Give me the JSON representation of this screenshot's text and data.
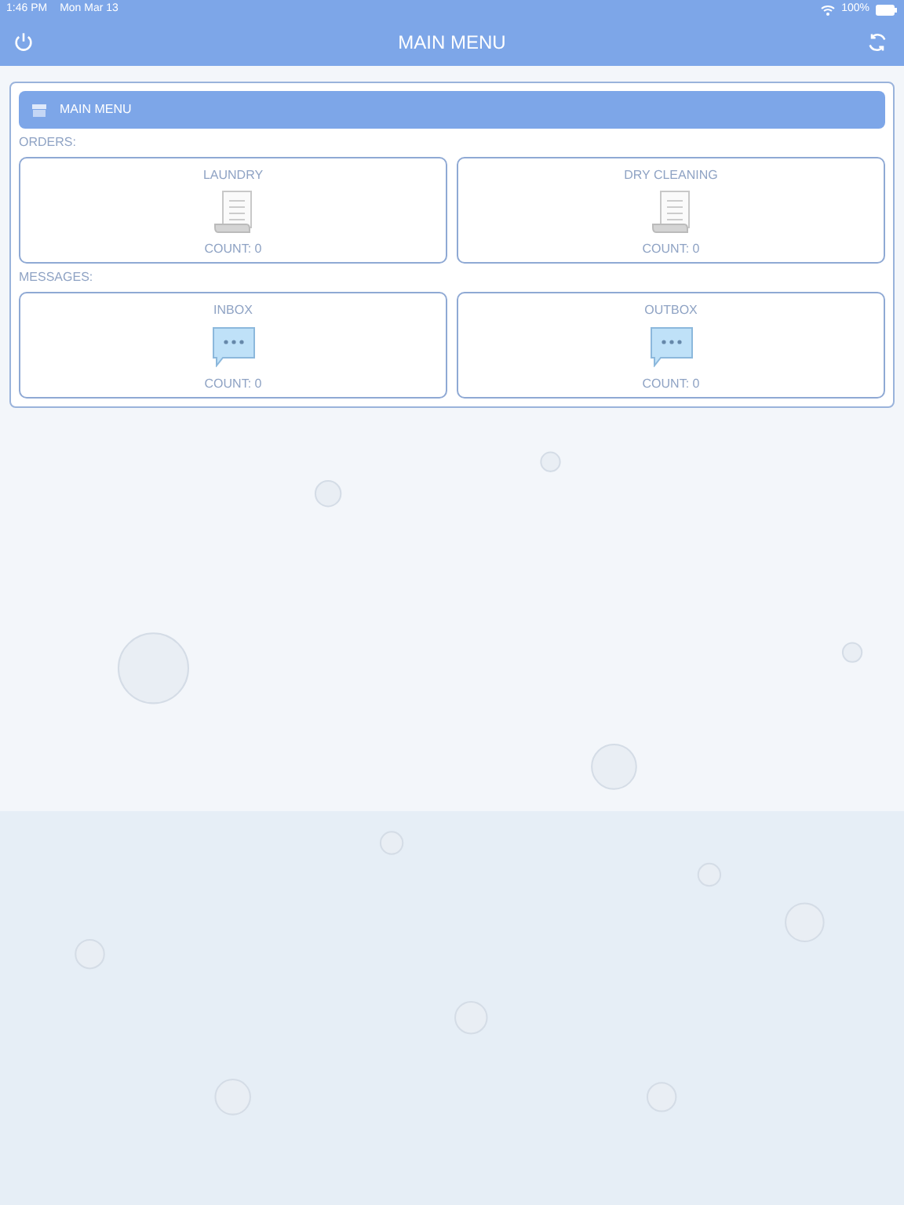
{
  "status_bar": {
    "time": "1:46 PM",
    "date": "Mon Mar 13",
    "battery": "100%"
  },
  "header": {
    "title": "MAIN MENU"
  },
  "panel": {
    "title": "MAIN MENU",
    "sections": [
      {
        "label": "ORDERS:",
        "tiles": [
          {
            "title": "LAUNDRY",
            "kind": "document",
            "count": "COUNT: 0"
          },
          {
            "title": "DRY CLEANING",
            "kind": "document",
            "count": "COUNT: 0"
          }
        ]
      },
      {
        "label": "MESSAGES:",
        "tiles": [
          {
            "title": "INBOX",
            "kind": "chat",
            "count": "COUNT: 0"
          },
          {
            "title": "OUTBOX",
            "kind": "chat",
            "count": "COUNT: 0"
          }
        ]
      }
    ]
  }
}
